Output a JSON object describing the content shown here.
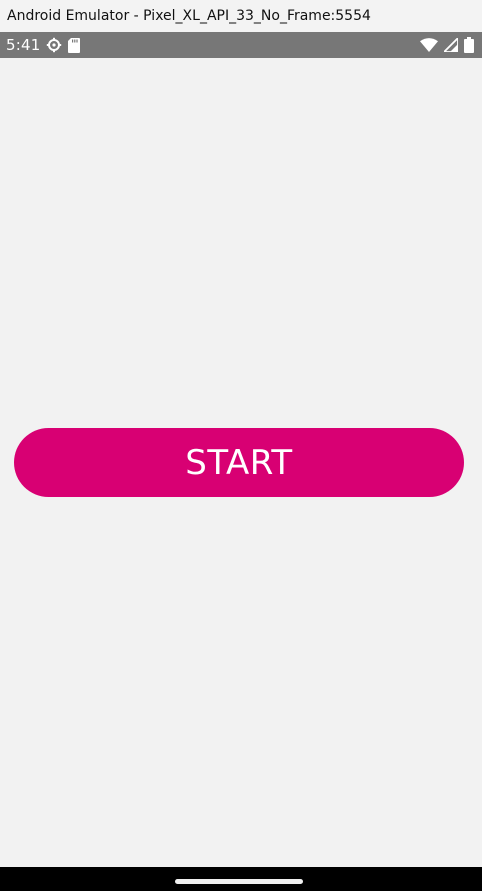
{
  "window": {
    "title": "Android Emulator - Pixel_XL_API_33_No_Frame:5554"
  },
  "status_bar": {
    "time": "5:41",
    "left_icons": [
      "gear-icon",
      "sd-card-icon"
    ],
    "right_icons": [
      "wifi-icon",
      "cellular-signal-icon",
      "battery-icon"
    ],
    "background": "#777777"
  },
  "main": {
    "start_button_label": "START",
    "button_color": "#d80073",
    "background": "#f2f2f2"
  },
  "nav_bar": {
    "background": "#000000",
    "handle": "home-handle"
  }
}
